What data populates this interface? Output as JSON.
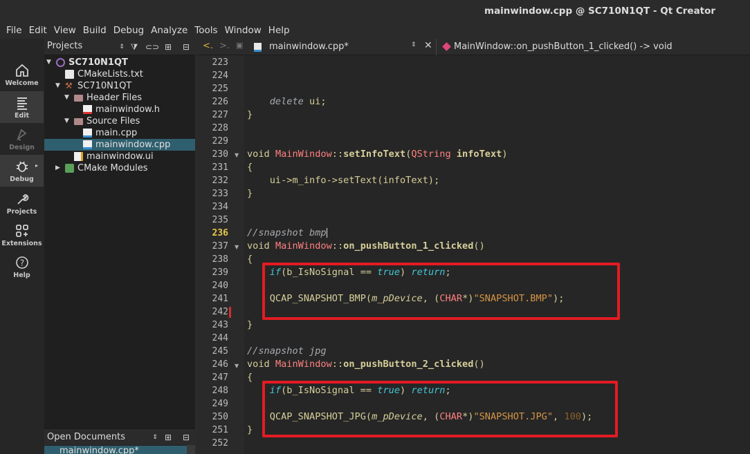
{
  "window": {
    "title": "mainwindow.cpp @ SC710N1QT - Qt Creator"
  },
  "menu": [
    "File",
    "Edit",
    "View",
    "Build",
    "Debug",
    "Analyze",
    "Tools",
    "Window",
    "Help"
  ],
  "modes": [
    {
      "label": "Welcome",
      "icon": "home-icon"
    },
    {
      "label": "Edit",
      "icon": "edit-icon"
    },
    {
      "label": "Design",
      "icon": "design-icon"
    },
    {
      "label": "Debug",
      "icon": "debug-icon"
    },
    {
      "label": "Projects",
      "icon": "wrench-icon"
    },
    {
      "label": "Extensions",
      "icon": "extensions-icon"
    },
    {
      "label": "Help",
      "icon": "help-icon"
    }
  ],
  "projects_pane": {
    "selector": "Projects",
    "tree": [
      {
        "label": "SC710N1QT",
        "icon": "project-icon"
      },
      {
        "label": "CMakeLists.txt",
        "icon": "cmake-file-icon"
      },
      {
        "label": "SC710N1QT",
        "icon": "hammer-icon"
      },
      {
        "label": "Header Files",
        "icon": "folder-icon"
      },
      {
        "label": "mainwindow.h",
        "icon": "header-file-icon"
      },
      {
        "label": "Source Files",
        "icon": "folder-icon"
      },
      {
        "label": "main.cpp",
        "icon": "cpp-file-icon"
      },
      {
        "label": "mainwindow.cpp",
        "icon": "cpp-file-icon"
      },
      {
        "label": "mainwindow.ui",
        "icon": "ui-file-icon"
      },
      {
        "label": "CMake Modules",
        "icon": "cmake-modules-icon"
      }
    ]
  },
  "open_documents": {
    "title": "Open Documents",
    "items": [
      "mainwindow.cpp*"
    ]
  },
  "editor": {
    "file_name": "mainwindow.cpp*",
    "function_signature": "MainWindow::on_pushButton_1_clicked() -> void",
    "current_line": "236",
    "line_numbers": [
      "223",
      "224",
      "225",
      "226",
      "227",
      "228",
      "229",
      "230",
      "231",
      "232",
      "233",
      "234",
      "235",
      "236",
      "237",
      "238",
      "239",
      "240",
      "241",
      "242",
      "243",
      "244",
      "245",
      "246",
      "247",
      "248",
      "249",
      "250",
      "251",
      "252"
    ],
    "code": {
      "l226_kw": "delete",
      "l226_rest": " ui;",
      "brace_close": "}",
      "brace_open": "{",
      "void": "void",
      "class_name": "MainWindow",
      "scope": "::",
      "set_info_fn": "setInfoText",
      "set_info_open": "(",
      "qstring": "QString",
      "info_param": " infoText",
      "close_paren": ")",
      "l232": "    ui->m_info->setText(infoText);",
      "comment_bmp": "//snapshot bmp",
      "btn1_fn": "on_pushButton_1_clicked",
      "parens": "()",
      "if_kw": "if",
      "cond_open": "(b_IsNoSignal == ",
      "true_kw": "true",
      "cond_close": ") ",
      "return_kw": "return",
      "semi": ";",
      "bmp_call": "QCAP_SNAPSHOT_BMP(",
      "m_pdevice": "m_pDevice",
      "comma_cast": ", (",
      "char_type": "CHAR",
      "cast_close": "*)",
      "bmp_str": "\"SNAPSHOT.BMP\"",
      "end_call": ");",
      "comment_jpg": "//snapshot jpg",
      "btn2_fn": "on_pushButton_2_clicked",
      "jpg_call": "QCAP_SNAPSHOT_JPG(",
      "jpg_str": "\"SNAPSHOT.JPG\"",
      "comma": ", ",
      "quality": "100"
    }
  },
  "colors": {
    "highlight_box": "#e31b23",
    "selection": "#2f5f6e",
    "keyword": "#45c6d6",
    "string": "#d69545",
    "type": "#ff8080"
  }
}
